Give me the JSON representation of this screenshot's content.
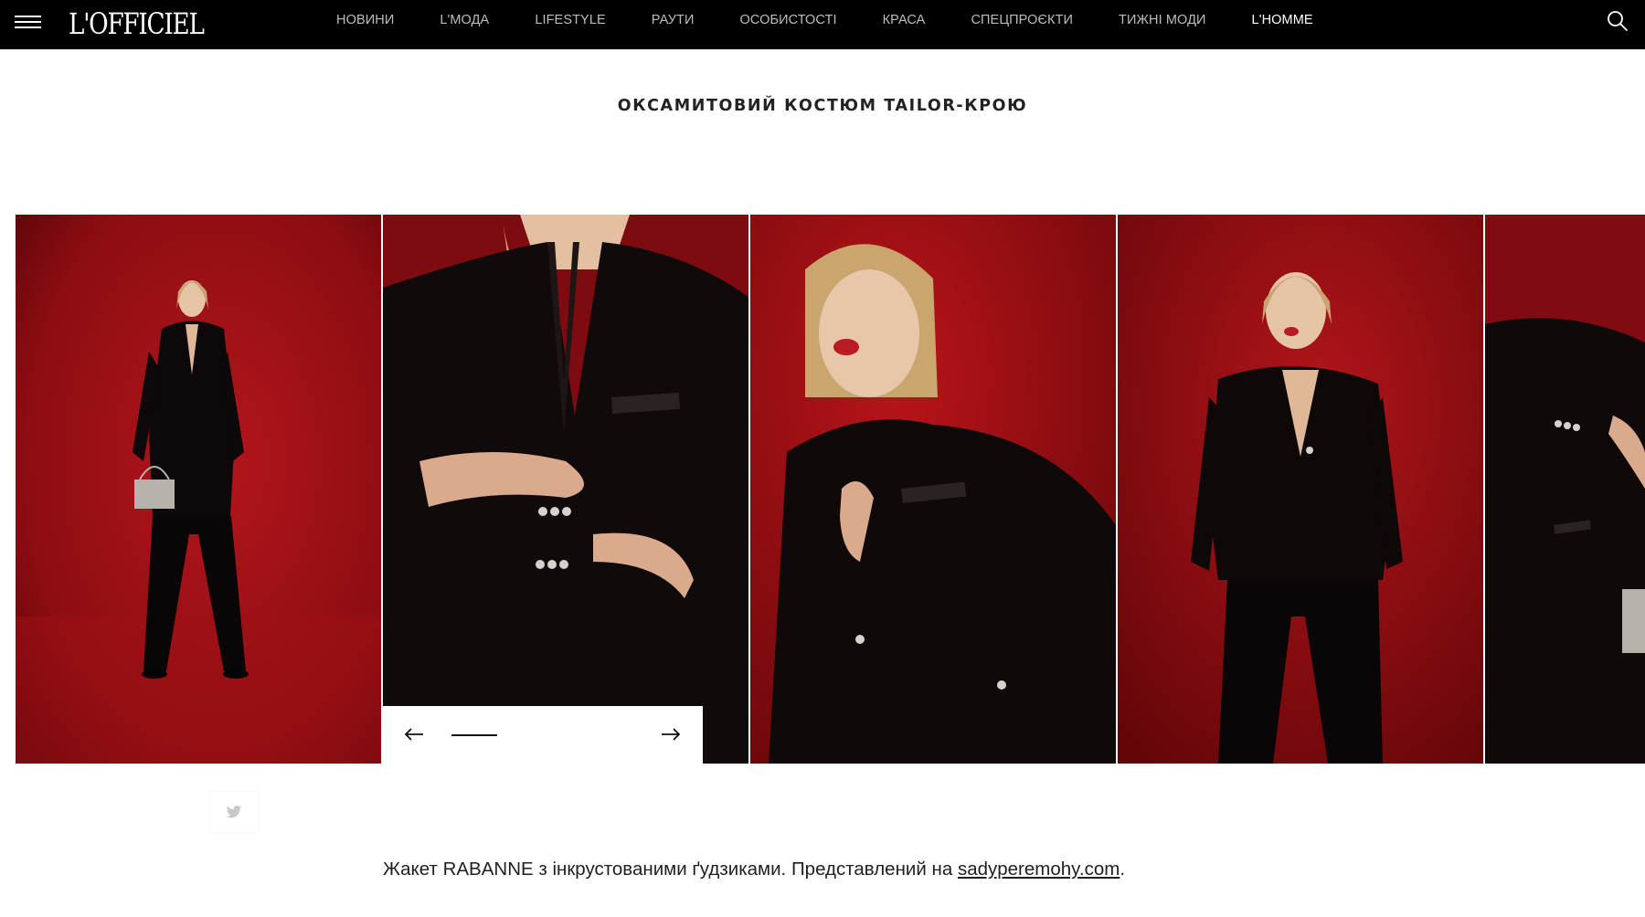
{
  "header": {
    "logo": "L'OFFICIEL",
    "menu_icon": "hamburger-menu-icon",
    "search_icon": "search-icon",
    "nav": [
      {
        "label": "НОВИНИ",
        "active": false
      },
      {
        "label": "L'МОДА",
        "active": false
      },
      {
        "label": "LIFESTYLE",
        "active": false
      },
      {
        "label": "РАУТИ",
        "active": false
      },
      {
        "label": "ОСОБИСТОСТІ",
        "active": false
      },
      {
        "label": "КРАСА",
        "active": false
      },
      {
        "label": "СПЕЦПРОЄКТИ",
        "active": false
      },
      {
        "label": "ТИЖНІ МОДИ",
        "active": false
      },
      {
        "label": "L'HOMME",
        "active": true
      }
    ],
    "colors": {
      "background": "#000000",
      "text": "#bdbdbd",
      "active": "#ffffff"
    }
  },
  "article": {
    "title": "ОКСАМИТОВИЙ КОСТЮМ TAILOR-КРОЮ"
  },
  "gallery": {
    "background_color": "#8e0e12",
    "prev_icon": "arrow-left-icon",
    "next_icon": "arrow-right-icon",
    "slides": [
      {
        "icon": "photo-full-length-suit"
      },
      {
        "icon": "photo-jacket-closeup"
      },
      {
        "icon": "photo-portrait-jacket"
      },
      {
        "icon": "photo-standing-suit"
      },
      {
        "icon": "photo-side-handbag"
      }
    ]
  },
  "share": {
    "icon": "twitter-icon"
  },
  "caption": {
    "text": "Жакет RABANNE з інкрустованими ґудзиками. Представлений на ",
    "link": "sadyperemohy.com",
    "suffix": "."
  }
}
